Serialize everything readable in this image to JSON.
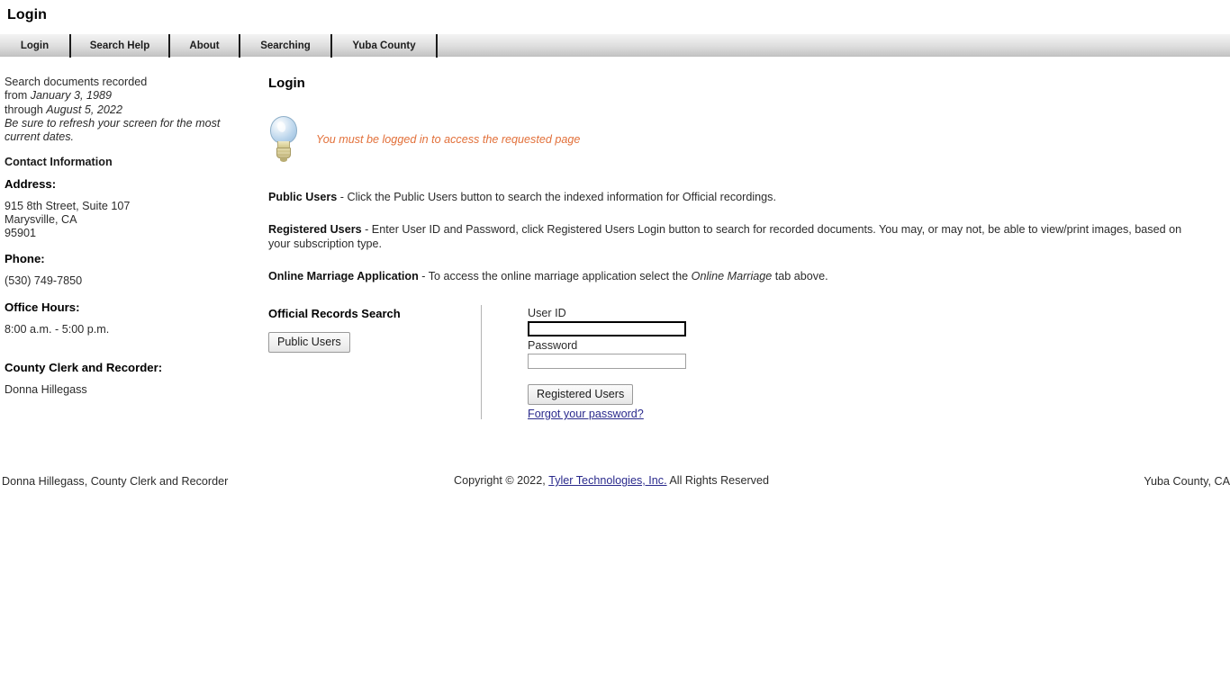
{
  "page": {
    "title": "Login",
    "content_heading": "Login"
  },
  "tabs": [
    {
      "label": "Login"
    },
    {
      "label": "Search Help"
    },
    {
      "label": "About"
    },
    {
      "label": "Searching"
    },
    {
      "label": "Yuba County"
    }
  ],
  "notice": {
    "icon": "lightbulb-icon",
    "text": "You must be logged in to access the requested page",
    "color": "#e2703a"
  },
  "sidebar": {
    "intro": {
      "line1": "Search documents recorded",
      "line2_prefix": "from ",
      "line2_date": "January 3, 1989",
      "line3_prefix": "through ",
      "line3_date": "August 5, 2022",
      "line4": "Be sure to refresh your screen for the most current dates."
    },
    "contact_heading": "Contact Information",
    "address_heading": "Address:",
    "address": "915 8th Street, Suite 107\nMarysville, CA\n95901",
    "phone_heading": "Phone:",
    "phone": "(530) 749-7850",
    "hours_heading": "Office Hours:",
    "hours": "8:00 a.m. - 5:00 p.m.",
    "clerk_heading": "County Clerk and Recorder:",
    "clerk_name": "Donna Hillegass"
  },
  "body": {
    "public_users": {
      "bold": "Public Users",
      "rest": " - Click the Public Users button to search the indexed information for Official recordings."
    },
    "registered_users": {
      "bold": "Registered Users",
      "rest": " - Enter User ID and Password, click Registered Users Login button to search for recorded documents. You may, or may not, be able to view/print images, based on your subscription type."
    },
    "online_marriage": {
      "bold": "Online Marriage Application",
      "rest_before": " - To access the online marriage application select the ",
      "italic": "Online Marriage",
      "rest_after": " tab above."
    }
  },
  "form": {
    "left_heading": "Official Records Search",
    "public_users_button": "Public Users",
    "user_id_label": "User ID",
    "user_id_value": "",
    "user_id_placeholder": "",
    "password_label": "Password",
    "password_value": "",
    "password_placeholder": "",
    "registered_users_button": "Registered Users",
    "forgot_password_link": "Forgot your password?"
  },
  "footer": {
    "left": "Donna Hillegass, County Clerk and Recorder",
    "copyright_prefix": "Copyright © 2022, ",
    "copyright_link": "Tyler Technologies, Inc.",
    "copyright_suffix": " All Rights Reserved",
    "right": "Yuba County, CA"
  }
}
